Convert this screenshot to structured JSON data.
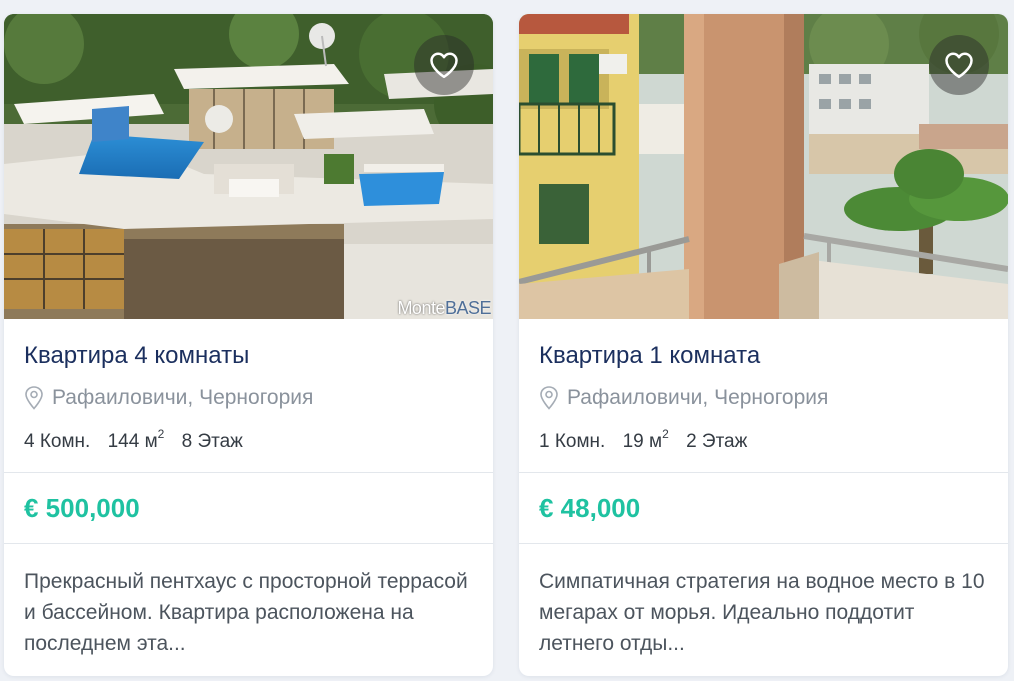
{
  "colors": {
    "page_background": "#eef1f6",
    "title": "#1b2f5e",
    "price": "#1fc2a1",
    "location": "#8a929c"
  },
  "listings": [
    {
      "title": "Квартира 4 комнаты",
      "location": "Рафаиловичи, Черногория",
      "rooms": "4 Комн.",
      "area": "144 м",
      "area_sup": "2",
      "floor": "8 Этаж",
      "price": "€ 500,000",
      "description": "Прекрасный пентхаус с просторной террасой и бассейном. Квартира расположена на последнем эта...",
      "watermark_a": "Monte",
      "watermark_b": "BASE",
      "favorite_icon": "heart-outline-icon",
      "location_icon": "map-pin-icon"
    },
    {
      "title": "Квартира 1 комната",
      "location": "Рафаиловичи, Черногория",
      "rooms": "1 Комн.",
      "area": "19 м",
      "area_sup": "2",
      "floor": "2 Этаж",
      "price": "€ 48,000",
      "description": "Симпатичная стратегия на водное место в 10 мегарах от морья. Идеально поддотит летнего отды...",
      "favorite_icon": "heart-outline-icon",
      "location_icon": "map-pin-icon"
    }
  ]
}
